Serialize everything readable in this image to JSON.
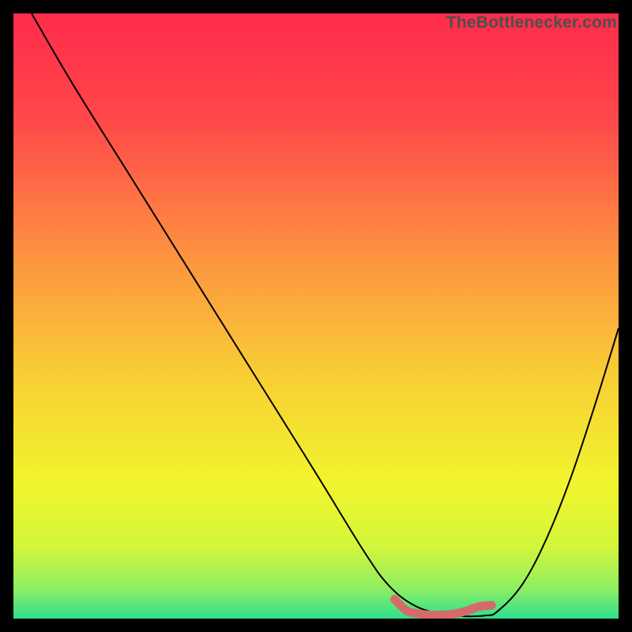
{
  "watermark": "TheBottlenecker.com",
  "chart_data": {
    "type": "line",
    "title": "",
    "xlabel": "",
    "ylabel": "",
    "xlim": [
      0,
      100
    ],
    "ylim": [
      0,
      100
    ],
    "grid": false,
    "background_gradient": {
      "stops": [
        {
          "offset": 0.0,
          "color": "#ff2b4b"
        },
        {
          "offset": 0.18,
          "color": "#ff494a"
        },
        {
          "offset": 0.4,
          "color": "#fd9240"
        },
        {
          "offset": 0.6,
          "color": "#f8cf35"
        },
        {
          "offset": 0.78,
          "color": "#f1f52e"
        },
        {
          "offset": 0.88,
          "color": "#d3f63a"
        },
        {
          "offset": 0.95,
          "color": "#8fee62"
        },
        {
          "offset": 1.0,
          "color": "#2ddf8e"
        }
      ]
    },
    "series": [
      {
        "name": "bottleneck-curve",
        "color": "#000000",
        "width": 2,
        "x": [
          3,
          10,
          20,
          30,
          40,
          50,
          58,
          62,
          66,
          70,
          74,
          78,
          80,
          84,
          88,
          92,
          96,
          100
        ],
        "y": [
          100,
          88,
          72,
          56,
          40,
          24,
          11,
          5.5,
          2.3,
          0.9,
          0.4,
          0.5,
          1.2,
          5.5,
          13,
          23,
          35,
          48
        ]
      }
    ],
    "highlight_band": {
      "name": "optimal-range",
      "color": "#d66a6a",
      "x": [
        63,
        79
      ],
      "y": [
        3.2,
        1.3,
        0.8,
        0.6,
        0.6,
        0.8,
        1.3,
        2.0,
        2.2
      ]
    },
    "highlight_point": {
      "name": "optimal-end-marker",
      "color": "#d66a6a",
      "x": 79,
      "y": 2.2,
      "r": 5.5
    }
  }
}
